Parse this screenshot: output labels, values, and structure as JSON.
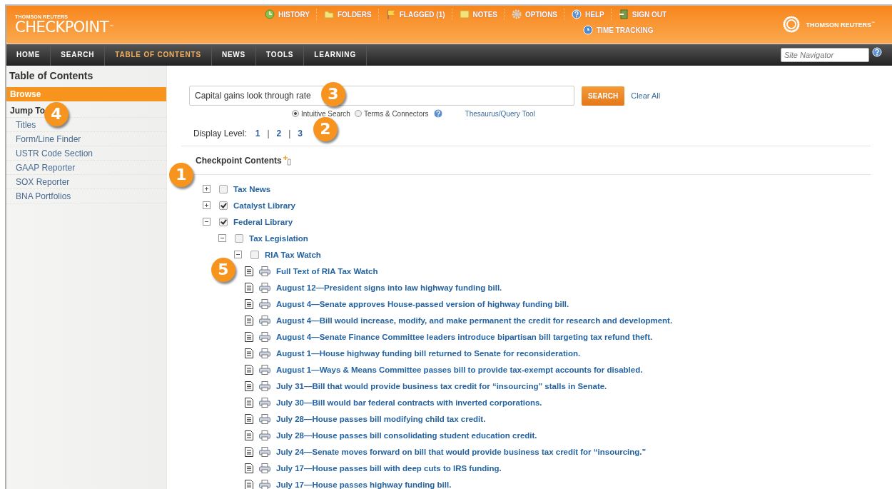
{
  "header": {
    "brand_small": "THOMSON REUTERS",
    "brand": "CHECKPOINT",
    "trademark": "™",
    "links": [
      "HISTORY",
      "FOLDERS",
      "FLAGGED (1)",
      "NOTES",
      "OPTIONS",
      "HELP",
      "SIGN OUT"
    ],
    "second_link": "TIME TRACKING",
    "company": "THOMSON REUTERS",
    "company_trademark": "™"
  },
  "nav": {
    "tabs": [
      {
        "label": "HOME",
        "selected": false
      },
      {
        "label": "SEARCH",
        "selected": false
      },
      {
        "label": "TABLE OF CONTENTS",
        "selected": true
      },
      {
        "label": "NEWS",
        "selected": false
      },
      {
        "label": "TOOLS",
        "selected": false
      },
      {
        "label": "LEARNING",
        "selected": false
      }
    ],
    "site_navigator": {
      "placeholder": "Site Navigator"
    }
  },
  "sidebar": {
    "title": "Table of Contents",
    "browse": {
      "label": "Browse",
      "selected": true
    },
    "jump_to": {
      "label": "Jump To",
      "callout": "4"
    },
    "items": [
      "Titles",
      "Form/Line Finder",
      "USTR Code Section",
      "GAAP Reporter",
      "SOX Reporter",
      "BNA Portfolios"
    ]
  },
  "search": {
    "value": "Capital gains look through rate",
    "callout": "3",
    "button": "SEARCH",
    "clear": "Clear All",
    "modes": [
      {
        "label": "Intuitive Search",
        "selected": true
      },
      {
        "label": "Terms & Connectors",
        "selected": false
      }
    ],
    "thesaurus": "Thesaurus/Query Tool"
  },
  "display_level": {
    "label": "Display Level:",
    "levels": [
      "1",
      "2",
      "3"
    ],
    "separator": "|",
    "callout": "2"
  },
  "contents": {
    "title": "Checkpoint Contents",
    "tree": [
      {
        "kind": "folder",
        "label": "Tax News",
        "expanded": false,
        "checked": false,
        "callout": "1"
      },
      {
        "kind": "folder",
        "label": "Catalyst Library",
        "expanded": false,
        "checked": true
      },
      {
        "kind": "folder",
        "label": "Federal Library",
        "expanded": true,
        "checked": true,
        "children": [
          {
            "kind": "folder",
            "label": "Tax Legislation",
            "expanded": true,
            "checked": false,
            "children": [
              {
                "kind": "folder",
                "label": "RIA Tax Watch",
                "expanded": true,
                "checked": false,
                "children": [
                  {
                    "kind": "document",
                    "label": "Full Text of RIA Tax Watch",
                    "callout": "5"
                  },
                  {
                    "kind": "document",
                    "label": "August 12—President signs into law highway funding bill."
                  },
                  {
                    "kind": "document",
                    "label": "August 4—Senate approves House-passed version of highway funding bill."
                  },
                  {
                    "kind": "document",
                    "label": "August 4—Bill would increase, modify, and make permanent the credit for research and development."
                  },
                  {
                    "kind": "document",
                    "label": "August 4—Senate Finance Committee leaders introduce bipartisan bill targeting tax refund theft."
                  },
                  {
                    "kind": "document",
                    "label": "August 1—House highway funding bill returned to Senate for reconsideration."
                  },
                  {
                    "kind": "document",
                    "label": "August 1—Ways & Means Committee passes bill to provide tax-exempt accounts for disabled."
                  },
                  {
                    "kind": "document",
                    "label": "July 31—Bill that would provide business tax credit for “insourcing” stalls in Senate."
                  },
                  {
                    "kind": "document",
                    "label": "July 30—Bill would bar federal contracts with inverted corporations."
                  },
                  {
                    "kind": "document",
                    "label": "July 28—House passes bill modifying child tax credit."
                  },
                  {
                    "kind": "document",
                    "label": "July 28—House passes bill consolidating student education credit."
                  },
                  {
                    "kind": "document",
                    "label": "July 24—Senate moves forward on bill that would provide business tax credit for “insourcing.”"
                  },
                  {
                    "kind": "document",
                    "label": "July 17—House passes bill with deep cuts to IRS funding."
                  },
                  {
                    "kind": "document",
                    "label": "July 17—House passes highway funding bill."
                  }
                ]
              }
            ]
          }
        ]
      }
    ]
  }
}
